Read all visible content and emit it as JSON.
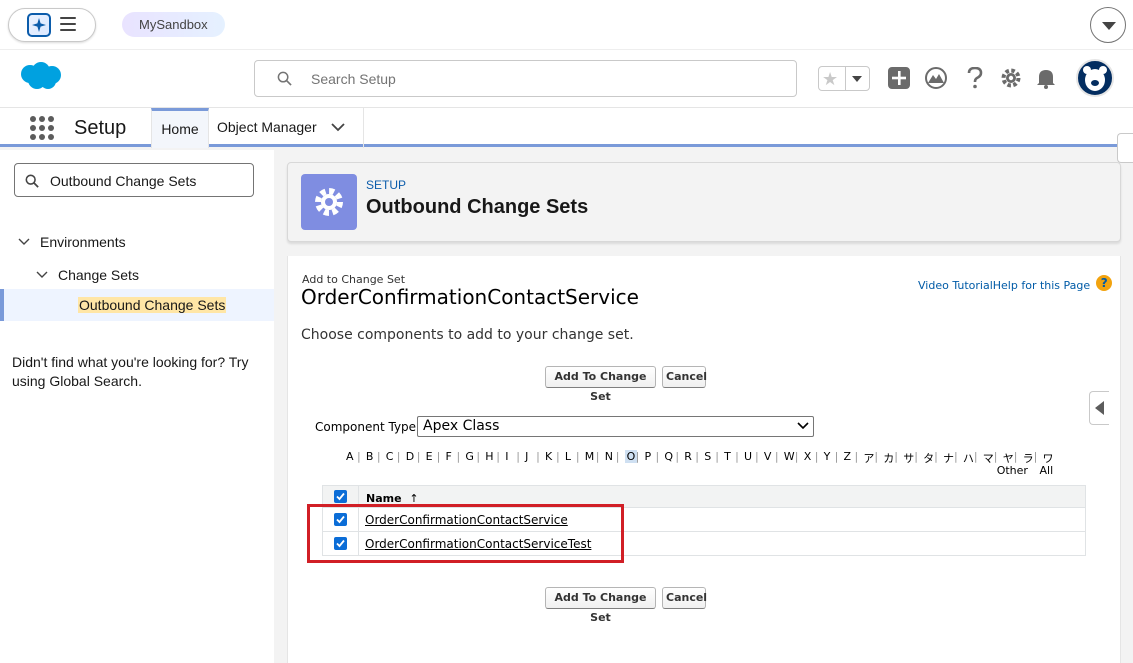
{
  "sandbox_bar": {
    "badge": "MySandbox"
  },
  "header": {
    "search_placeholder": "Search Setup"
  },
  "context_bar": {
    "app_name": "Setup",
    "tabs": [
      {
        "label": "Home",
        "active": true
      },
      {
        "label": "Object Manager",
        "active": false
      }
    ]
  },
  "sidebar": {
    "quickfind_value": "Outbound Change Sets",
    "tree": [
      {
        "label": "Environments",
        "level": 0
      },
      {
        "label": "Change Sets",
        "level": 1
      },
      {
        "label": "Outbound Change Sets",
        "level": 2,
        "selected": true
      }
    ],
    "no_find_text": "Didn't find what you're looking for? Try using Global Search."
  },
  "page_header": {
    "eyebrow": "SETUP",
    "title": "Outbound Change Sets"
  },
  "content": {
    "crumb": "Add to Change Set",
    "changeset_name": "OrderConfirmationContactService",
    "video_tutorial": "Video Tutorial",
    "help_page": "Help for this Page",
    "help_symbol": "?",
    "instructions": "Choose components to add to your change set.",
    "add_button": "Add To Change Set",
    "cancel_button": "Cancel",
    "component_type_label": "Component Type:",
    "component_type_value": "Apex Class",
    "alphabet": [
      "A",
      "B",
      "C",
      "D",
      "E",
      "F",
      "G",
      "H",
      "I",
      "J",
      "K",
      "L",
      "M",
      "N",
      "O",
      "P",
      "Q",
      "R",
      "S",
      "T",
      "U",
      "V",
      "W",
      "X",
      "Y",
      "Z",
      "ア",
      "カ",
      "サ",
      "タ",
      "ナ",
      "ハ",
      "マ",
      "ヤ",
      "ラ",
      "ワ"
    ],
    "alphabet_selected": "O",
    "alpha_other": "Other",
    "alpha_all": "All",
    "table": {
      "column_name": "Name",
      "sort_arrow": "↑",
      "rows": [
        {
          "name": "OrderConfirmationContactService",
          "checked": true
        },
        {
          "name": "OrderConfirmationContactServiceTest",
          "checked": true
        }
      ]
    }
  },
  "colors": {
    "brand_blue": "#0b5cab",
    "selection_bar": "#7a9ad9",
    "gear_tile": "#7f8de1",
    "highlight_red": "#d11f26",
    "checkbox_blue": "#0b6dd7",
    "help_orange": "#f2a30f"
  },
  "icons": [
    "agent-icon",
    "hamburger-icon",
    "salesforce-cloud-logo",
    "search-icon",
    "star-icon",
    "add-icon",
    "trailhead-icon",
    "help-icon",
    "gear-icon",
    "bell-icon",
    "avatar",
    "waffle-icon",
    "chevron-down-icon",
    "check-icon"
  ]
}
